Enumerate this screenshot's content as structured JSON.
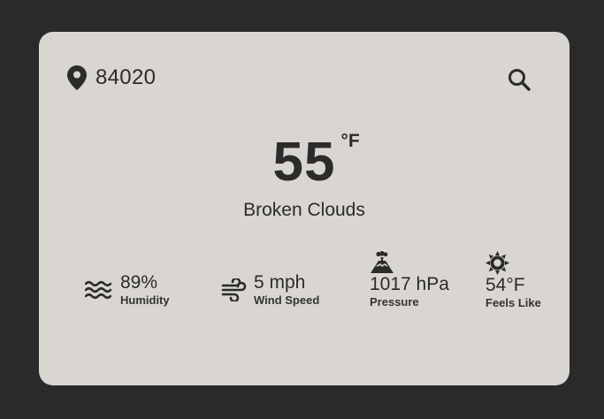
{
  "location": {
    "zip": "84020",
    "pin_icon": "map-pin-icon",
    "search_icon": "search-icon"
  },
  "current": {
    "temperature": "55",
    "unit": "°F",
    "description": "Broken Clouds"
  },
  "stats": {
    "humidity": {
      "value": "89%",
      "label": "Humidity",
      "icon": "humidity-waves-icon"
    },
    "wind": {
      "value": "5 mph",
      "label": "Wind Speed",
      "icon": "wind-icon"
    },
    "pressure": {
      "value": "1017 hPa",
      "label": "Pressure",
      "icon": "volcano-pressure-icon"
    },
    "feels_like": {
      "value": "54°F",
      "label": "Feels Like",
      "icon": "sun-icon"
    }
  },
  "colors": {
    "page_background": "#2a2a2a",
    "card_background": "#d9d6d2",
    "text": "#2b2b2b"
  }
}
